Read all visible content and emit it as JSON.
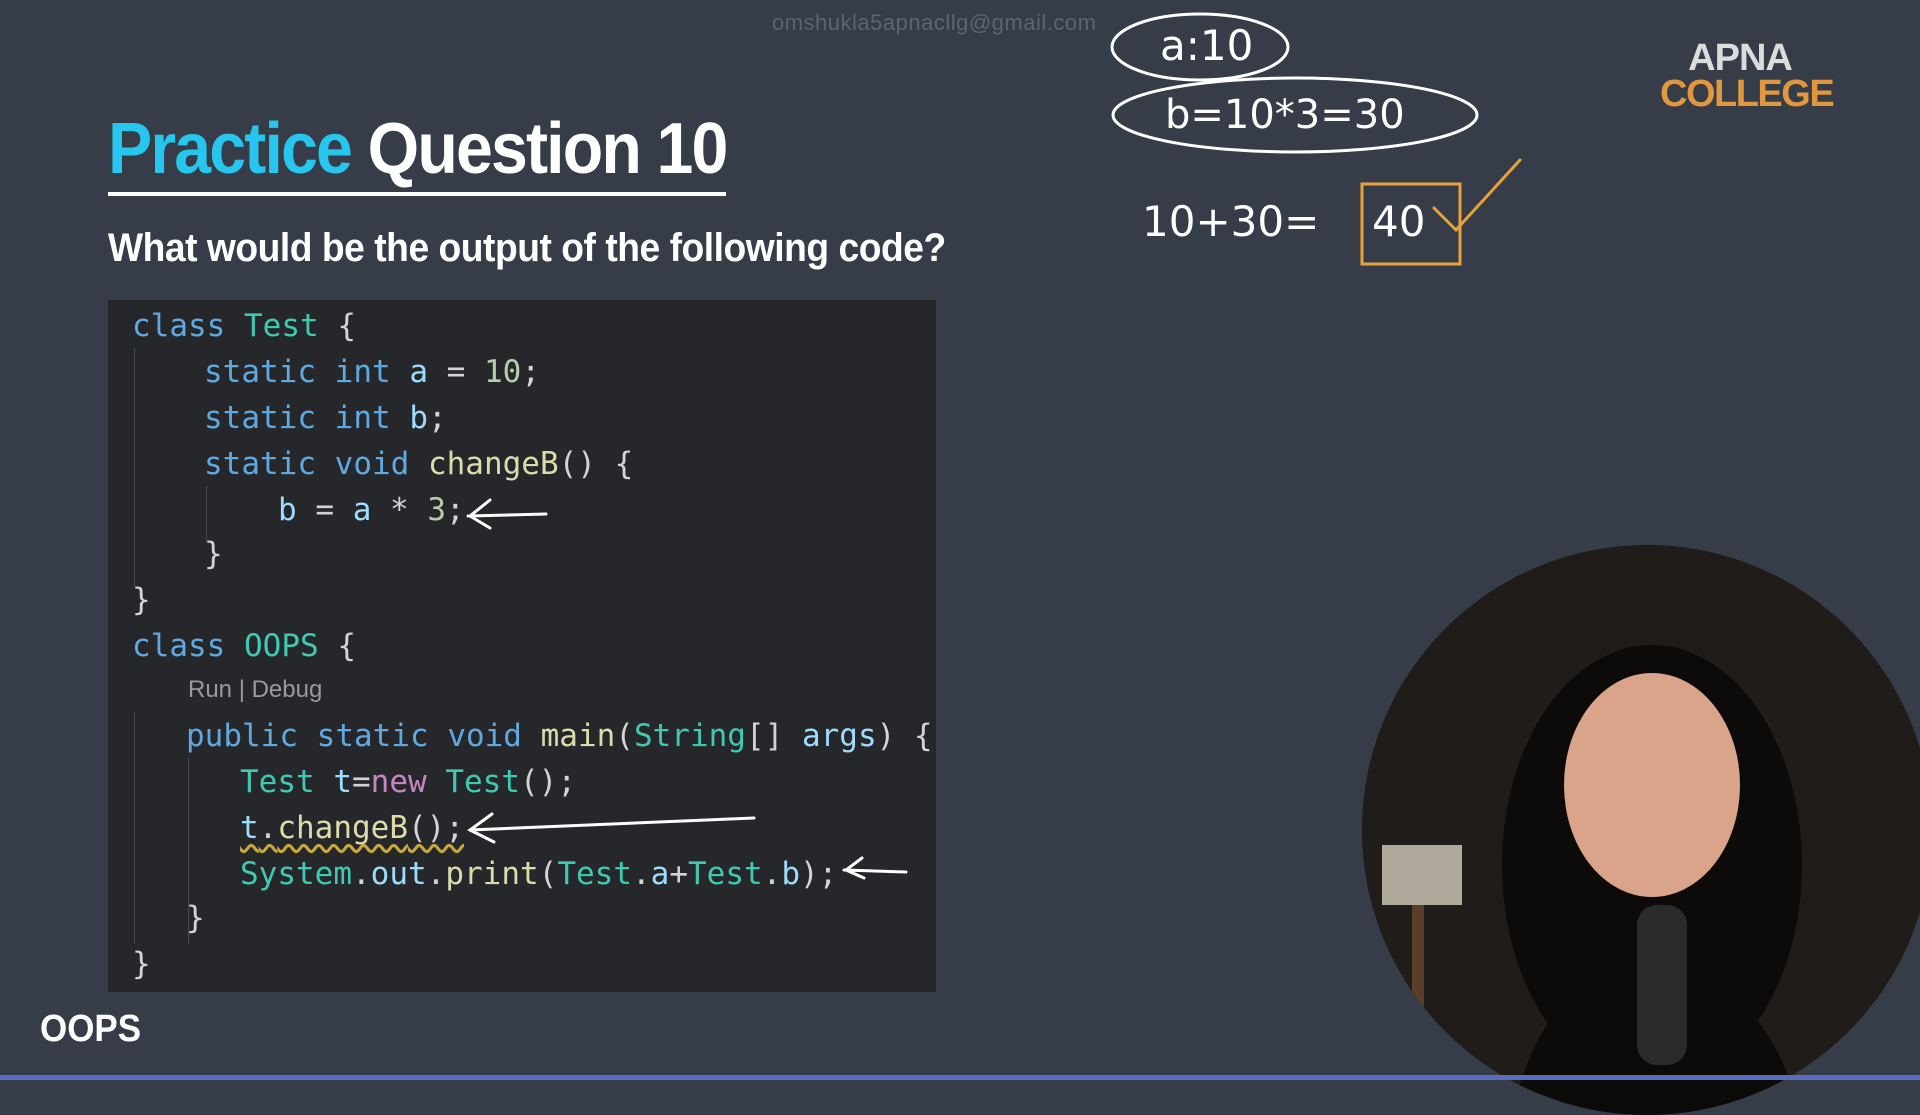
{
  "watermark": "omshukla5apnacllg@gmail.com",
  "logo": {
    "line1": "APNA",
    "line2": "COLLEGE"
  },
  "title": {
    "highlight": "Practice",
    "rest": "Question 10"
  },
  "question": "What would be the output of the following code?",
  "code": {
    "line1": {
      "kw": "class",
      "name": "Test",
      "brace": "{"
    },
    "line2": {
      "kw": "static",
      "type": "int",
      "var": "a",
      "eq": "=",
      "num": "10",
      "semi": ";"
    },
    "line3": {
      "kw": "static",
      "type": "int",
      "var": "b",
      "semi": ";"
    },
    "line4": {
      "kw": "static",
      "type": "void",
      "fn": "changeB",
      "rest": "() {"
    },
    "line5": {
      "var1": "b",
      "eq": "=",
      "var2": "a",
      "op": "*",
      "num": "3",
      "semi": ";"
    },
    "line6": "}",
    "line7": "}",
    "line8": {
      "kw": "class",
      "name": "OOPS",
      "brace": "{"
    },
    "codelens": "Run | Debug",
    "line9": {
      "kw1": "public",
      "kw2": "static",
      "kw3": "void",
      "fn": "main",
      "p1": "(",
      "type": "String",
      "p2": "[]",
      "var": "args",
      "p3": ") {"
    },
    "line10": {
      "type": "Test",
      "var": "t",
      "eq": "=",
      "kw": "new",
      "type2": "Test",
      "rest": "();"
    },
    "line11": {
      "var": "t",
      "dot": ".",
      "fn": "changeB",
      "rest": "();"
    },
    "line12": {
      "cls": "System",
      "dot1": ".",
      "field": "out",
      "dot2": ".",
      "fn": "print",
      "p1": "(",
      "t1": "Test",
      "d1": ".",
      "a": "a",
      "plus": "+",
      "t2": "Test",
      "d2": ".",
      "b": "b",
      "p2": ");"
    },
    "line13": "}",
    "line14": "}"
  },
  "annotations": {
    "a_value": "a:10",
    "b_value": "b=10*3=30",
    "sum": "10+30=",
    "answer": "40"
  },
  "footer": "OOPS",
  "colors": {
    "background": "#363d48",
    "accent": "#27c6ee",
    "logo_orange": "#e0973d",
    "ink_orange": "#e8a23a"
  }
}
